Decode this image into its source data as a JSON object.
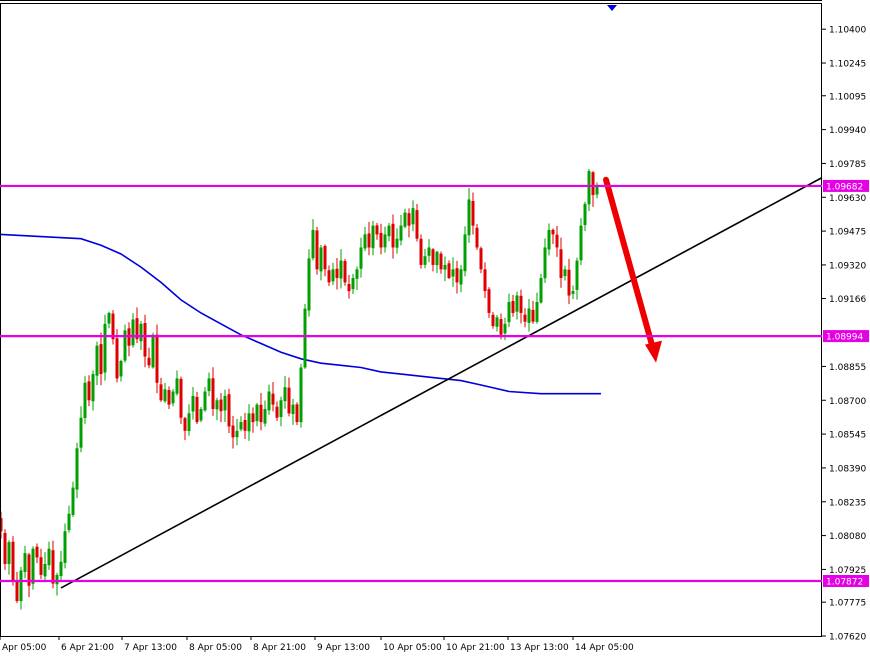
{
  "chart_data": {
    "type": "candlestick",
    "title": "",
    "xlabel": "",
    "ylabel": "",
    "y_range": [
      1.0762,
      1.1052
    ],
    "y_ticks": [
      "1.10400",
      "1.10245",
      "1.10095",
      "1.09940",
      "1.09785",
      "1.09630",
      "1.09475",
      "1.09320",
      "1.09166",
      "1.08855",
      "1.08700",
      "1.08545",
      "1.08390",
      "1.08235",
      "1.08080",
      "1.07925",
      "1.07775",
      "1.07620"
    ],
    "x_ticks": [
      "Apr 05:00",
      "6 Apr 21:00",
      "7 Apr 13:00",
      "8 Apr 05:00",
      "8 Apr 21:00",
      "9 Apr 13:00",
      "10 Apr 05:00",
      "10 Apr 21:00",
      "13 Apr 13:00",
      "14 Apr 05:00"
    ],
    "horizontal_levels": [
      {
        "label": "1.09682",
        "value": 1.09682,
        "color": "#e600e6"
      },
      {
        "label": "1.08994",
        "value": 1.08994,
        "color": "#e600e6"
      },
      {
        "label": "1.07872",
        "value": 1.07872,
        "color": "#e600e6"
      }
    ],
    "trendline": {
      "from": {
        "bar": 0,
        "price": 1.0784
      },
      "to": {
        "bar": 172,
        "price": 1.0972
      },
      "color": "#000000"
    },
    "arrow": {
      "from": {
        "bar": 150,
        "price": 1.0971
      },
      "to": {
        "bar": 161,
        "price": 1.089
      },
      "color": "#ee0000"
    },
    "moving_average": {
      "color": "#0000dd",
      "points": [
        [
          0,
          1.0946
        ],
        [
          10,
          1.0945
        ],
        [
          20,
          1.0944
        ],
        [
          25,
          1.0941
        ],
        [
          30,
          1.0937
        ],
        [
          35,
          1.0931
        ],
        [
          40,
          1.0924
        ],
        [
          45,
          1.0916
        ],
        [
          50,
          1.091
        ],
        [
          55,
          1.0905
        ],
        [
          60,
          1.09
        ],
        [
          65,
          1.0896
        ],
        [
          70,
          1.0892
        ],
        [
          75,
          1.0889
        ],
        [
          80,
          1.0887
        ],
        [
          85,
          1.0886
        ],
        [
          90,
          1.0885
        ],
        [
          95,
          1.0883
        ],
        [
          100,
          1.0882
        ],
        [
          110,
          1.088
        ],
        [
          115,
          1.0879
        ],
        [
          120,
          1.0877
        ],
        [
          127,
          1.0874
        ],
        [
          135,
          1.0873
        ],
        [
          145,
          1.0873
        ],
        [
          150,
          1.0873
        ]
      ]
    },
    "closes": [
      1.081,
      1.0795,
      1.0805,
      1.0787,
      1.0778,
      1.0792,
      1.08,
      1.0785,
      1.0802,
      1.0798,
      1.079,
      1.0795,
      1.0802,
      1.0786,
      1.079,
      1.0796,
      1.081,
      1.0818,
      1.083,
      1.0848,
      1.0862,
      1.0878,
      1.087,
      1.0882,
      1.0895,
      1.0882,
      1.0905,
      1.091,
      1.0898,
      1.088,
      1.0888,
      1.0902,
      1.0895,
      1.0907,
      1.0898,
      1.0905,
      1.089,
      1.0886,
      1.09,
      1.0878,
      1.087,
      1.0875,
      1.0868,
      1.0874,
      1.088,
      1.0862,
      1.0856,
      1.0864,
      1.0872,
      1.086,
      1.0866,
      1.0874,
      1.088,
      1.0866,
      1.087,
      1.0865,
      1.0872,
      1.0858,
      1.0853,
      1.0856,
      1.086,
      1.0856,
      1.0864,
      1.086,
      1.0868,
      1.086,
      1.0866,
      1.0874,
      1.0868,
      1.0862,
      1.087,
      1.0876,
      1.0864,
      1.0868,
      1.086,
      1.0885,
      1.0912,
      1.0935,
      1.0948,
      1.093,
      1.094,
      1.093,
      1.0924,
      1.093,
      1.0926,
      1.0934,
      1.0924,
      1.092,
      1.0926,
      1.093,
      1.094,
      1.0946,
      1.094,
      1.095,
      1.0946,
      1.094,
      1.0946,
      1.095,
      1.094,
      1.0944,
      1.095,
      1.0956,
      1.095,
      1.0958,
      1.0944,
      1.0932,
      1.0936,
      1.094,
      1.0932,
      1.0938,
      1.093,
      1.0932,
      1.0926,
      1.093,
      1.0924,
      1.093,
      1.0946,
      1.0962,
      1.095,
      1.094,
      1.093,
      1.092,
      1.091,
      1.0904,
      1.0908,
      1.09,
      1.0905,
      1.0915,
      1.091,
      1.0918,
      1.091,
      1.0906,
      1.0912,
      1.0906,
      1.0915,
      1.0926,
      1.094,
      1.0948,
      1.0946,
      1.094,
      1.0926,
      1.093,
      1.0918,
      1.092,
      1.0934,
      1.095,
      1.096,
      1.0975,
      1.0964,
      1.0968
    ],
    "candle_colors": {
      "up": "#00a000",
      "down": "#e00000"
    }
  }
}
